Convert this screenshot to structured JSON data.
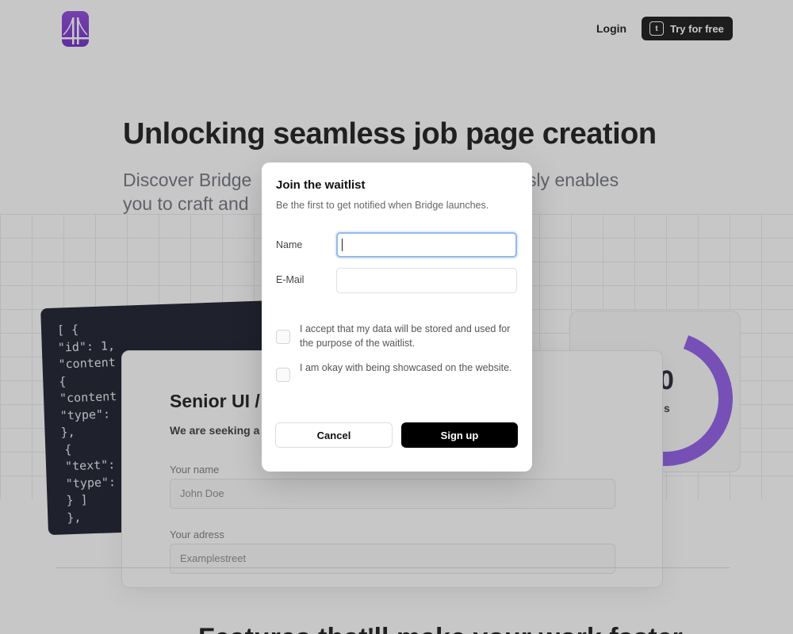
{
  "header": {
    "logo_name": "bridge-logo-icon",
    "login_label": "Login",
    "try_label": "Try for free",
    "try_icon_glyph": "t"
  },
  "hero": {
    "title": "Unlocking seamless job page creation",
    "subtitle_line1_left": "Discover Bridge",
    "subtitle_line1_right": "sly enables",
    "subtitle_line2_left": "you to craft and"
  },
  "code_card": {
    "lines": [
      "[ {",
      "\"id\": 1,",
      "\"content",
      "{",
      "\"content",
      "\"type\":",
      "},",
      "{",
      "\"text\":",
      "\"type\":",
      "} ]",
      "},"
    ]
  },
  "job_card": {
    "title": "Senior UI /",
    "description": "We are seeking a",
    "fields": [
      {
        "label": "Your name",
        "value": "John Doe"
      },
      {
        "label": "Your adress",
        "value": "Examplestreet"
      }
    ]
  },
  "gauge_card": {
    "number": "0",
    "label": "s",
    "accent": "#8b55e6"
  },
  "bottom": {
    "heading": "Features that'll make your work faster"
  },
  "modal": {
    "title": "Join the waitlist",
    "subtitle": "Be the first to get notified when Bridge launches.",
    "name_label": "Name",
    "name_value": "",
    "email_label": "E-Mail",
    "email_value": "",
    "consent_text": "I accept that my data will be stored and used for the purpose of the waitlist.",
    "showcase_text": "I am okay with being showcased on the website.",
    "cancel_label": "Cancel",
    "signup_label": "Sign up"
  },
  "colors": {
    "brand": "#7a2fd0",
    "overlay": "rgba(70,70,74,0.30)",
    "focus_ring": "#93b9e8"
  }
}
